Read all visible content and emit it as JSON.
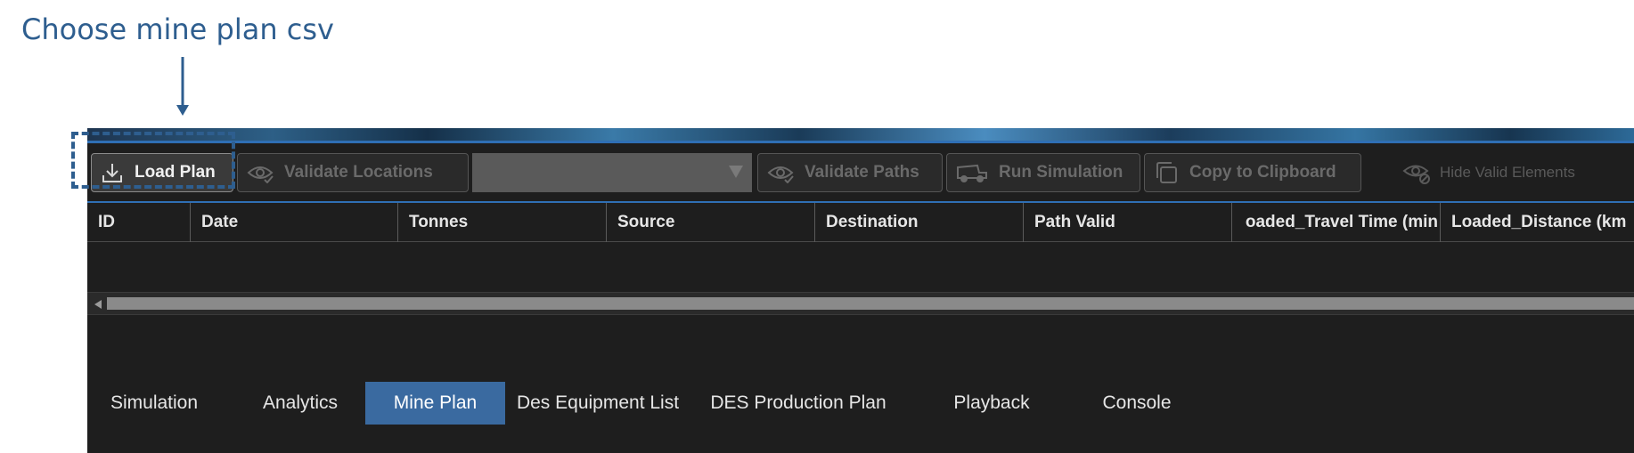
{
  "annotation": {
    "title": "Choose mine plan csv"
  },
  "toolbar": {
    "load_plan": "Load Plan",
    "validate_locations": "Validate Locations",
    "dropdown_value": "",
    "validate_paths": "Validate Paths",
    "run_simulation": "Run Simulation",
    "copy_to_clipboard": "Copy to Clipboard",
    "hide_valid_elements": "Hide Valid Elements"
  },
  "table": {
    "columns": [
      "ID",
      "Date",
      "Tonnes",
      "Source",
      "Destination",
      "Path Valid",
      "oaded_Travel Time (min",
      "Loaded_Distance (km"
    ]
  },
  "tabs": [
    {
      "label": "Simulation",
      "active": false
    },
    {
      "label": "Analytics",
      "active": false
    },
    {
      "label": "Mine Plan",
      "active": true
    },
    {
      "label": "Des Equipment List",
      "active": false
    },
    {
      "label": "DES Production Plan",
      "active": false
    },
    {
      "label": "Playback",
      "active": false
    },
    {
      "label": "Console",
      "active": false
    }
  ],
  "colors": {
    "annotation": "#2e5e8f",
    "accent": "#2f6fb5",
    "active_tab": "#3a6aa0",
    "background": "#1e1e1e"
  }
}
